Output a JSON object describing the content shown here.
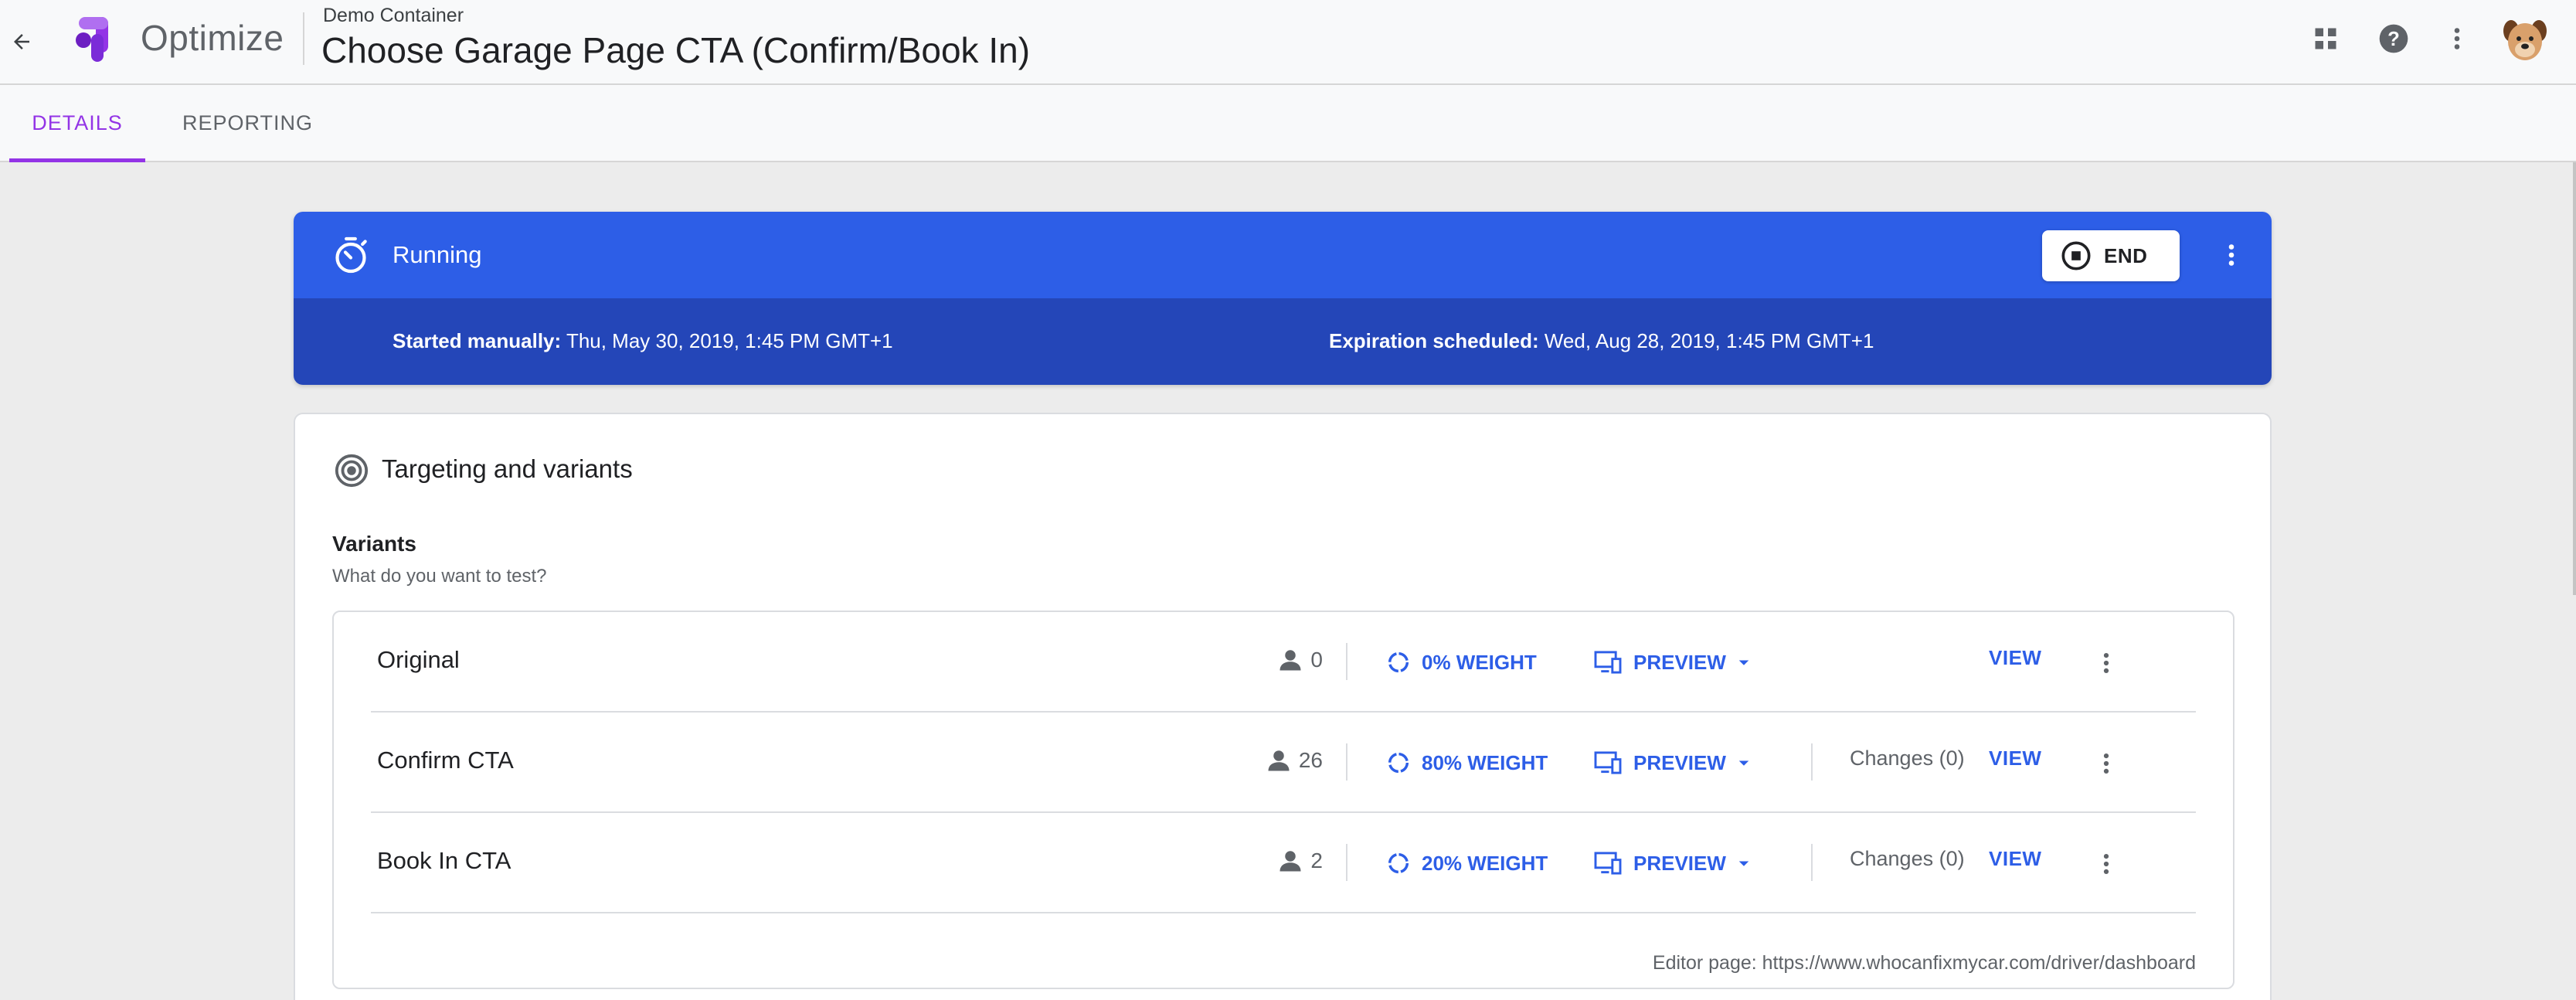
{
  "header": {
    "app_name": "Optimize",
    "container_name": "Demo Container",
    "experiment_title": "Choose Garage Page CTA (Confirm/Book In)"
  },
  "tabs": [
    {
      "label": "DETAILS",
      "active": true
    },
    {
      "label": "REPORTING",
      "active": false
    }
  ],
  "status_card": {
    "status": "Running",
    "end_label": "END",
    "started_label": "Started manually:",
    "started_value": "Thu, May 30, 2019, 1:45 PM GMT+1",
    "expiration_label": "Expiration scheduled:",
    "expiration_value": "Wed, Aug 28, 2019, 1:45 PM GMT+1"
  },
  "targeting": {
    "title": "Targeting and variants",
    "variants_title": "Variants",
    "variants_subtitle": "What do you want to test?",
    "variants": [
      {
        "name": "Original",
        "users": "0",
        "weight": "0% WEIGHT",
        "preview": "PREVIEW",
        "changes": "",
        "view": "VIEW"
      },
      {
        "name": "Confirm CTA",
        "users": "26",
        "weight": "80% WEIGHT",
        "preview": "PREVIEW",
        "changes": "Changes (0)",
        "view": "VIEW"
      },
      {
        "name": "Book In CTA",
        "users": "2",
        "weight": "20% WEIGHT",
        "preview": "PREVIEW",
        "changes": "Changes (0)",
        "view": "VIEW"
      }
    ],
    "editor_page": "Editor page: https://www.whocanfixmycar.com/driver/dashboard"
  },
  "colors": {
    "accent_purple": "#9334e6",
    "running_blue": "#2d5ee7",
    "running_blue_dark": "#2446b8",
    "link_blue": "#2d5ee7"
  },
  "icons": [
    "back-arrow-icon",
    "optimize-logo-icon",
    "apps-grid-icon",
    "help-icon",
    "more-vert-icon",
    "avatar",
    "timer-icon",
    "stop-circle-icon",
    "target-icon",
    "person-icon",
    "weight-ring-icon",
    "preview-devices-icon",
    "dropdown-arrow-icon"
  ]
}
